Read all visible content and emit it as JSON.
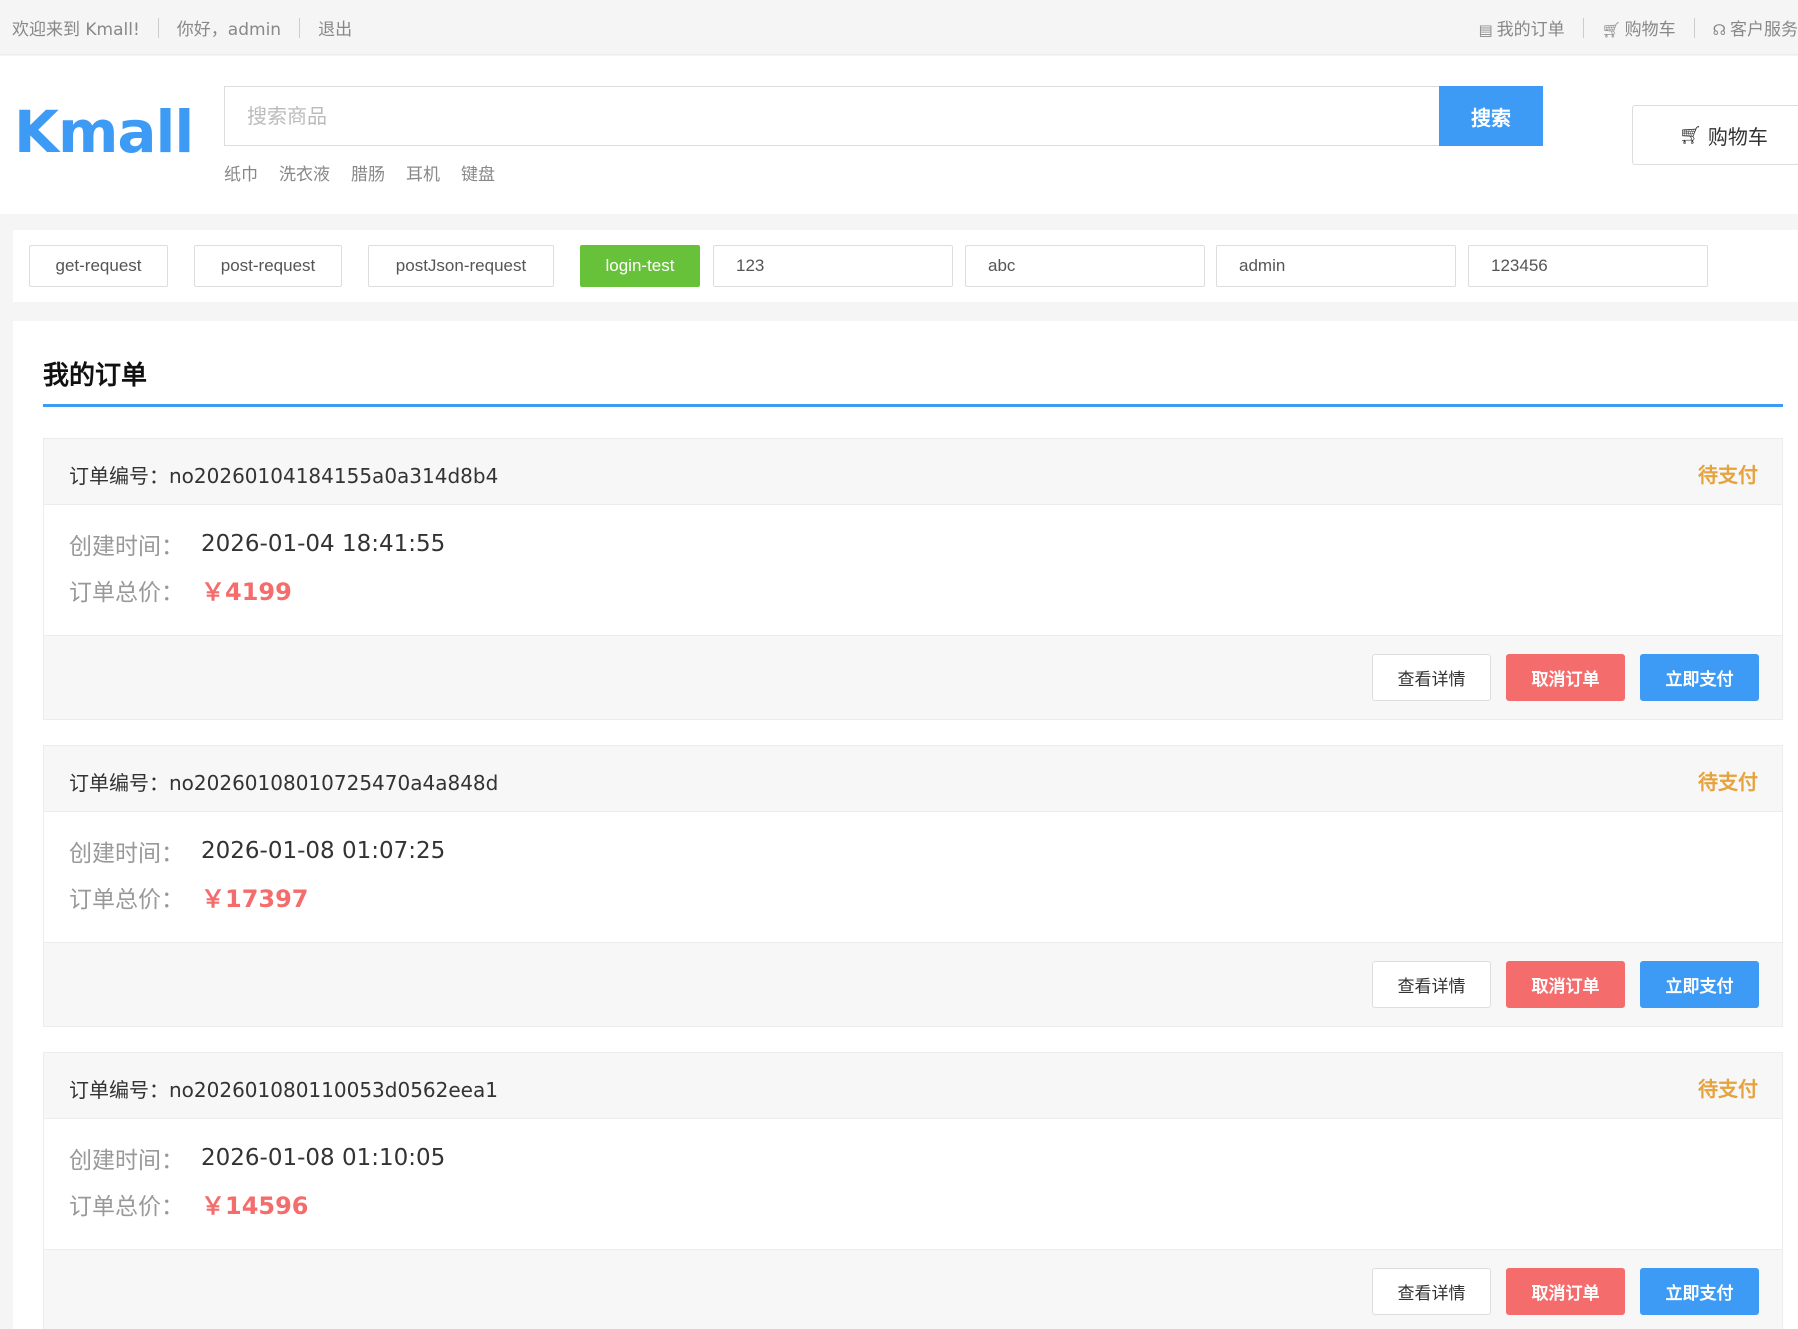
{
  "topbar": {
    "welcome": "欢迎来到 Kmall!",
    "greeting": "你好，admin",
    "logout": "退出",
    "my_orders": "我的订单",
    "cart": "购物车",
    "service": "客户服务"
  },
  "header": {
    "logo": "Kmall",
    "search_placeholder": "搜索商品",
    "search_button": "搜索",
    "hotwords": [
      "纸巾",
      "洗衣液",
      "腊肠",
      "耳机",
      "键盘"
    ],
    "cart_button": "购物车"
  },
  "toolbar": {
    "get_request": "get-request",
    "post_request": "post-request",
    "post_json_request": "postJson-request",
    "login_test": "login-test",
    "input1": "123",
    "input2": "abc",
    "input3": "admin",
    "input4": "123456"
  },
  "main": {
    "title": "我的订单",
    "labels": {
      "order_no": "订单编号：",
      "created": "创建时间：",
      "total": "订单总价："
    },
    "buttons": {
      "detail": "查看详情",
      "cancel": "取消订单",
      "pay": "立即支付"
    },
    "orders": [
      {
        "no": "no20260104184155a0a314d8b4",
        "status": "待支付",
        "created": "2026-01-04 18:41:55",
        "total": "￥4199"
      },
      {
        "no": "no20260108010725470a4a848d",
        "status": "待支付",
        "created": "2026-01-08 01:07:25",
        "total": "￥17397"
      },
      {
        "no": "no202601080110053d0562eea1",
        "status": "待支付",
        "created": "2026-01-08 01:10:05",
        "total": "￥14596"
      }
    ]
  },
  "colors": {
    "accent": "#3d9bf5",
    "green": "#67c23a",
    "danger": "#f56c6c",
    "warning": "#e6a23c"
  }
}
